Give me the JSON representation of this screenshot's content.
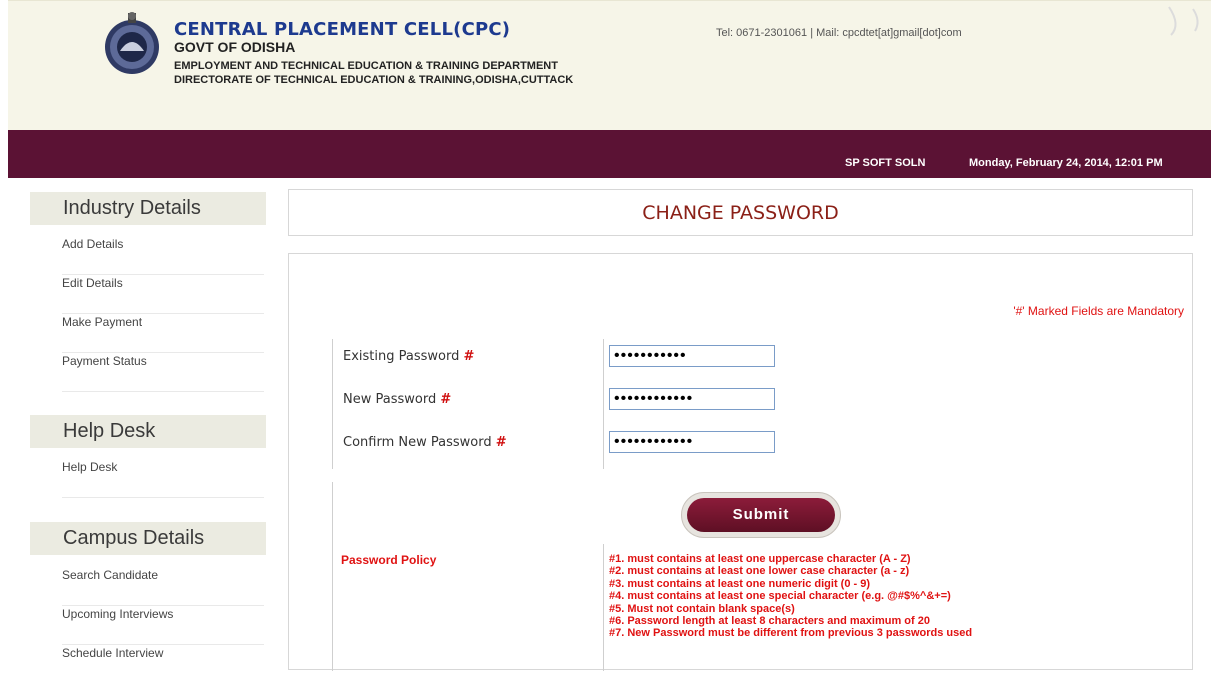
{
  "header": {
    "title": "CENTRAL PLACEMENT CELL(CPC)",
    "govt": "GOVT OF ODISHA",
    "dept": "EMPLOYMENT AND TECHNICAL EDUCATION & TRAINING DEPARTMENT",
    "directorate": "DIRECTORATE OF TECHNICAL EDUCATION & TRAINING,ODISHA,CUTTACK",
    "contact": "Tel: 0671-2301061 | Mail: cpcdtet[at]gmail[dot]com"
  },
  "banner": {
    "company": "SP SOFT SOLN",
    "datetime": "Monday, February 24, 2014, 12:01 PM"
  },
  "sidebar": {
    "sections": [
      {
        "title": "Industry Details",
        "items": [
          "Add Details",
          "Edit Details",
          "Make Payment",
          "Payment Status"
        ]
      },
      {
        "title": "Help Desk",
        "items": [
          "Help Desk"
        ]
      },
      {
        "title": "Campus Details",
        "items": [
          "Search Candidate",
          "Upcoming Interviews",
          "Schedule Interview"
        ]
      }
    ]
  },
  "page": {
    "title": "CHANGE PASSWORD",
    "mandatory_note": "'#' Marked Fields are Mandatory"
  },
  "form": {
    "fields": [
      {
        "label": "Existing Password",
        "mark": "#",
        "value": "•••••••••••"
      },
      {
        "label": "New Password",
        "mark": "#",
        "value": "••••••••••••"
      },
      {
        "label": "Confirm New Password",
        "mark": "#",
        "value": "••••••••••••"
      }
    ],
    "submit_label": "Submit"
  },
  "policy": {
    "label": "Password Policy",
    "rules": [
      "#1. must contains at least one uppercase character (A - Z)",
      "#2. must contains at least one lower case character (a - z)",
      "#3. must contains at least one numeric digit (0 - 9)",
      "#4. must contains at least one special character (e.g. @#$%^&+=)",
      "#5. Must not contain blank space(s)",
      "#6. Password length at least 8 characters and maximum of 20",
      "#7. New Password must be different from previous 3 passwords used"
    ]
  },
  "colors": {
    "banner": "#5b1234",
    "title_text": "#8b2017",
    "alert_red": "#e01212",
    "header_bg": "#f6f5e8"
  }
}
